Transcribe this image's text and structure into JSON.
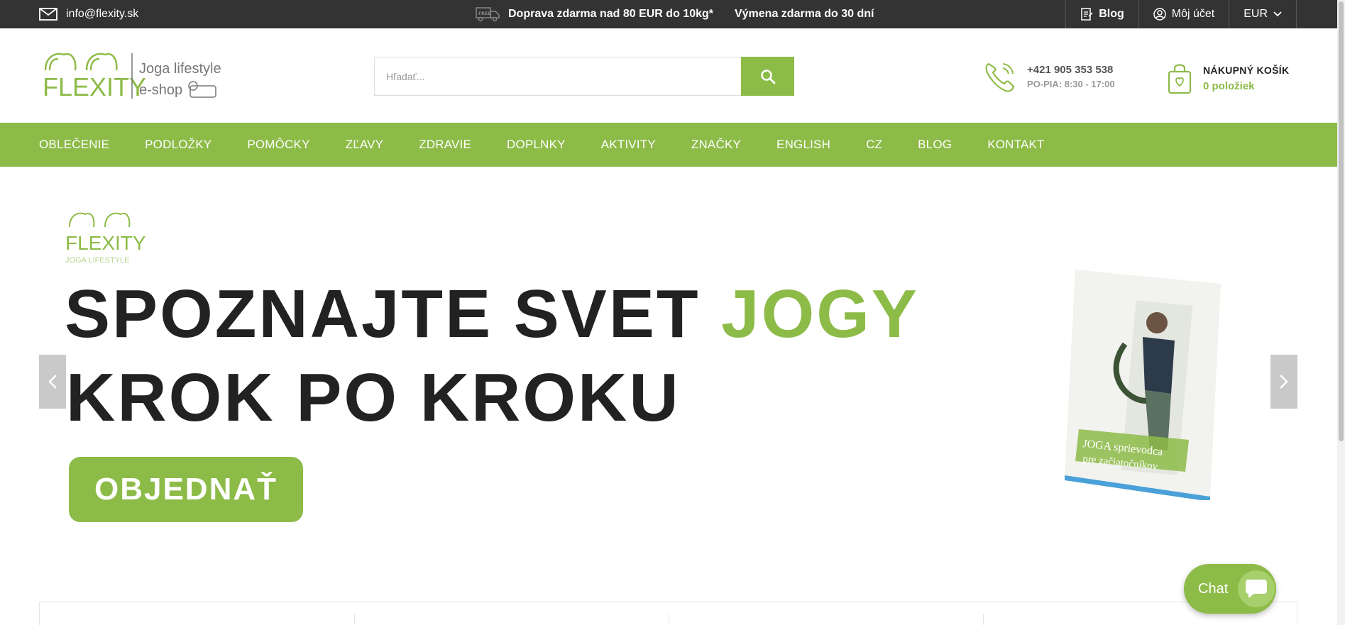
{
  "topbar": {
    "email": "info@flexity.sk",
    "promo_shipping": "Doprava zdarma nad 80 EUR do 10kg*",
    "promo_exchange": "Výmena zdarma do 30 dní",
    "truck_badge": "FREE",
    "blog_label": "Blog",
    "account_label": "Môj účet",
    "currency_label": "EUR"
  },
  "logo": {
    "brand": "FLEXITY",
    "tagline_1": "Joga lifestyle",
    "tagline_2": "e-shop"
  },
  "search": {
    "placeholder": "Hľadať..."
  },
  "contact": {
    "phone": "+421 905 353 538",
    "hours": "PO-PIA: 8:30 - 17:00"
  },
  "cart": {
    "title": "NÁKUPNÝ KOŠÍK",
    "count": "0 položiek"
  },
  "nav": {
    "items": [
      {
        "label": "OBLEČENIE"
      },
      {
        "label": "PODLOŽKY"
      },
      {
        "label": "POMÔCKY"
      },
      {
        "label": "ZĽAVY"
      },
      {
        "label": "ZDRAVIE"
      },
      {
        "label": "DOPLNKY"
      },
      {
        "label": "AKTIVITY"
      },
      {
        "label": "ZNAČKY"
      },
      {
        "label": "ENGLISH"
      },
      {
        "label": "CZ"
      },
      {
        "label": "BLOG"
      },
      {
        "label": "KONTAKT"
      }
    ]
  },
  "hero": {
    "logo_brand": "FLEXITY",
    "logo_tagline": "JOGA LIFESTYLE",
    "line1": "SPOZNAJTE SVET",
    "line1_accent": "JOGY",
    "line2": "KROK PO KROKU",
    "cta": "OBJEDNAŤ",
    "book_title": "JOGA sprievodca",
    "book_subtitle": "pre začiatočníkov"
  },
  "chat": {
    "label": "Chat"
  },
  "colors": {
    "brand_green": "#8dbb48",
    "topbar_bg": "#333333"
  },
  "icons": {
    "email": "envelope-icon",
    "truck": "truck-icon",
    "blog": "document-icon",
    "account": "user-circle-icon",
    "currency": "chevron-down-icon",
    "search": "search-icon",
    "phone": "phone-icon",
    "cart": "shopping-bag-icon",
    "slider_prev": "chevron-left-icon",
    "slider_next": "chevron-right-icon",
    "chat": "chat-bubble-icon"
  }
}
